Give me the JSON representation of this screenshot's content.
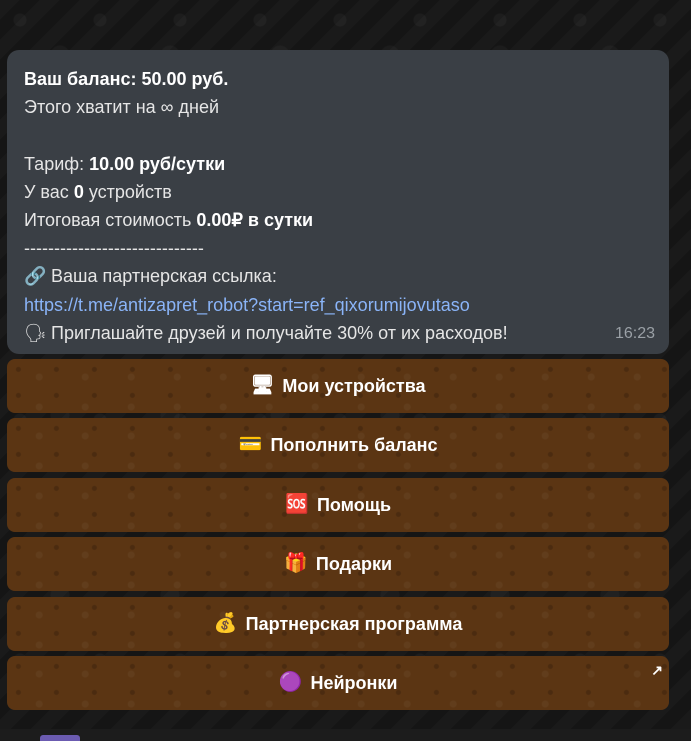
{
  "message": {
    "balance_label": "Ваш баланс: ",
    "balance_value": "50.00 руб.",
    "enough_prefix": "Этого хватит на ",
    "enough_value": "∞",
    "enough_suffix": " дней",
    "tariff_label": "Тариф: ",
    "tariff_value": "10.00 руб/сутки",
    "devices_prefix": "У вас ",
    "devices_count": "0",
    "devices_suffix": " устройств",
    "total_prefix": "Итоговая стоимость ",
    "total_value": "0.00₽ в сутки",
    "separator": "------------------------------",
    "partner_link_label": "Ваша партнерская ссылка:",
    "partner_link_icon": "link-icon",
    "partner_link_url": "https://t.me/antizapret_robot?start=ref_qixorumijovutaso",
    "invite_icon": "speech-bubble-icon",
    "invite_text": "Приглашайте друзей и получайте 30% от их расходов!",
    "time": "16:23"
  },
  "keyboard": {
    "buttons": [
      {
        "label": "Мои устройства",
        "icon": "computer-icon",
        "glyph": "🖥"
      },
      {
        "label": "Пополнить баланс",
        "icon": "card-icon",
        "glyph": "💳"
      },
      {
        "label": "Помощь",
        "icon": "sos-icon",
        "glyph": "🆘"
      },
      {
        "label": "Подарки",
        "icon": "gift-icon",
        "glyph": "🎁"
      },
      {
        "label": "Партнерская программа",
        "icon": "money-bag-icon",
        "glyph": "💰"
      },
      {
        "label": "Нейронки",
        "icon": "purple-circle-icon",
        "glyph": "🟣"
      }
    ]
  },
  "colors": {
    "button_bg": "#5b3513",
    "bubble_bg": "#3a3f45",
    "link": "#8ab4f8"
  }
}
